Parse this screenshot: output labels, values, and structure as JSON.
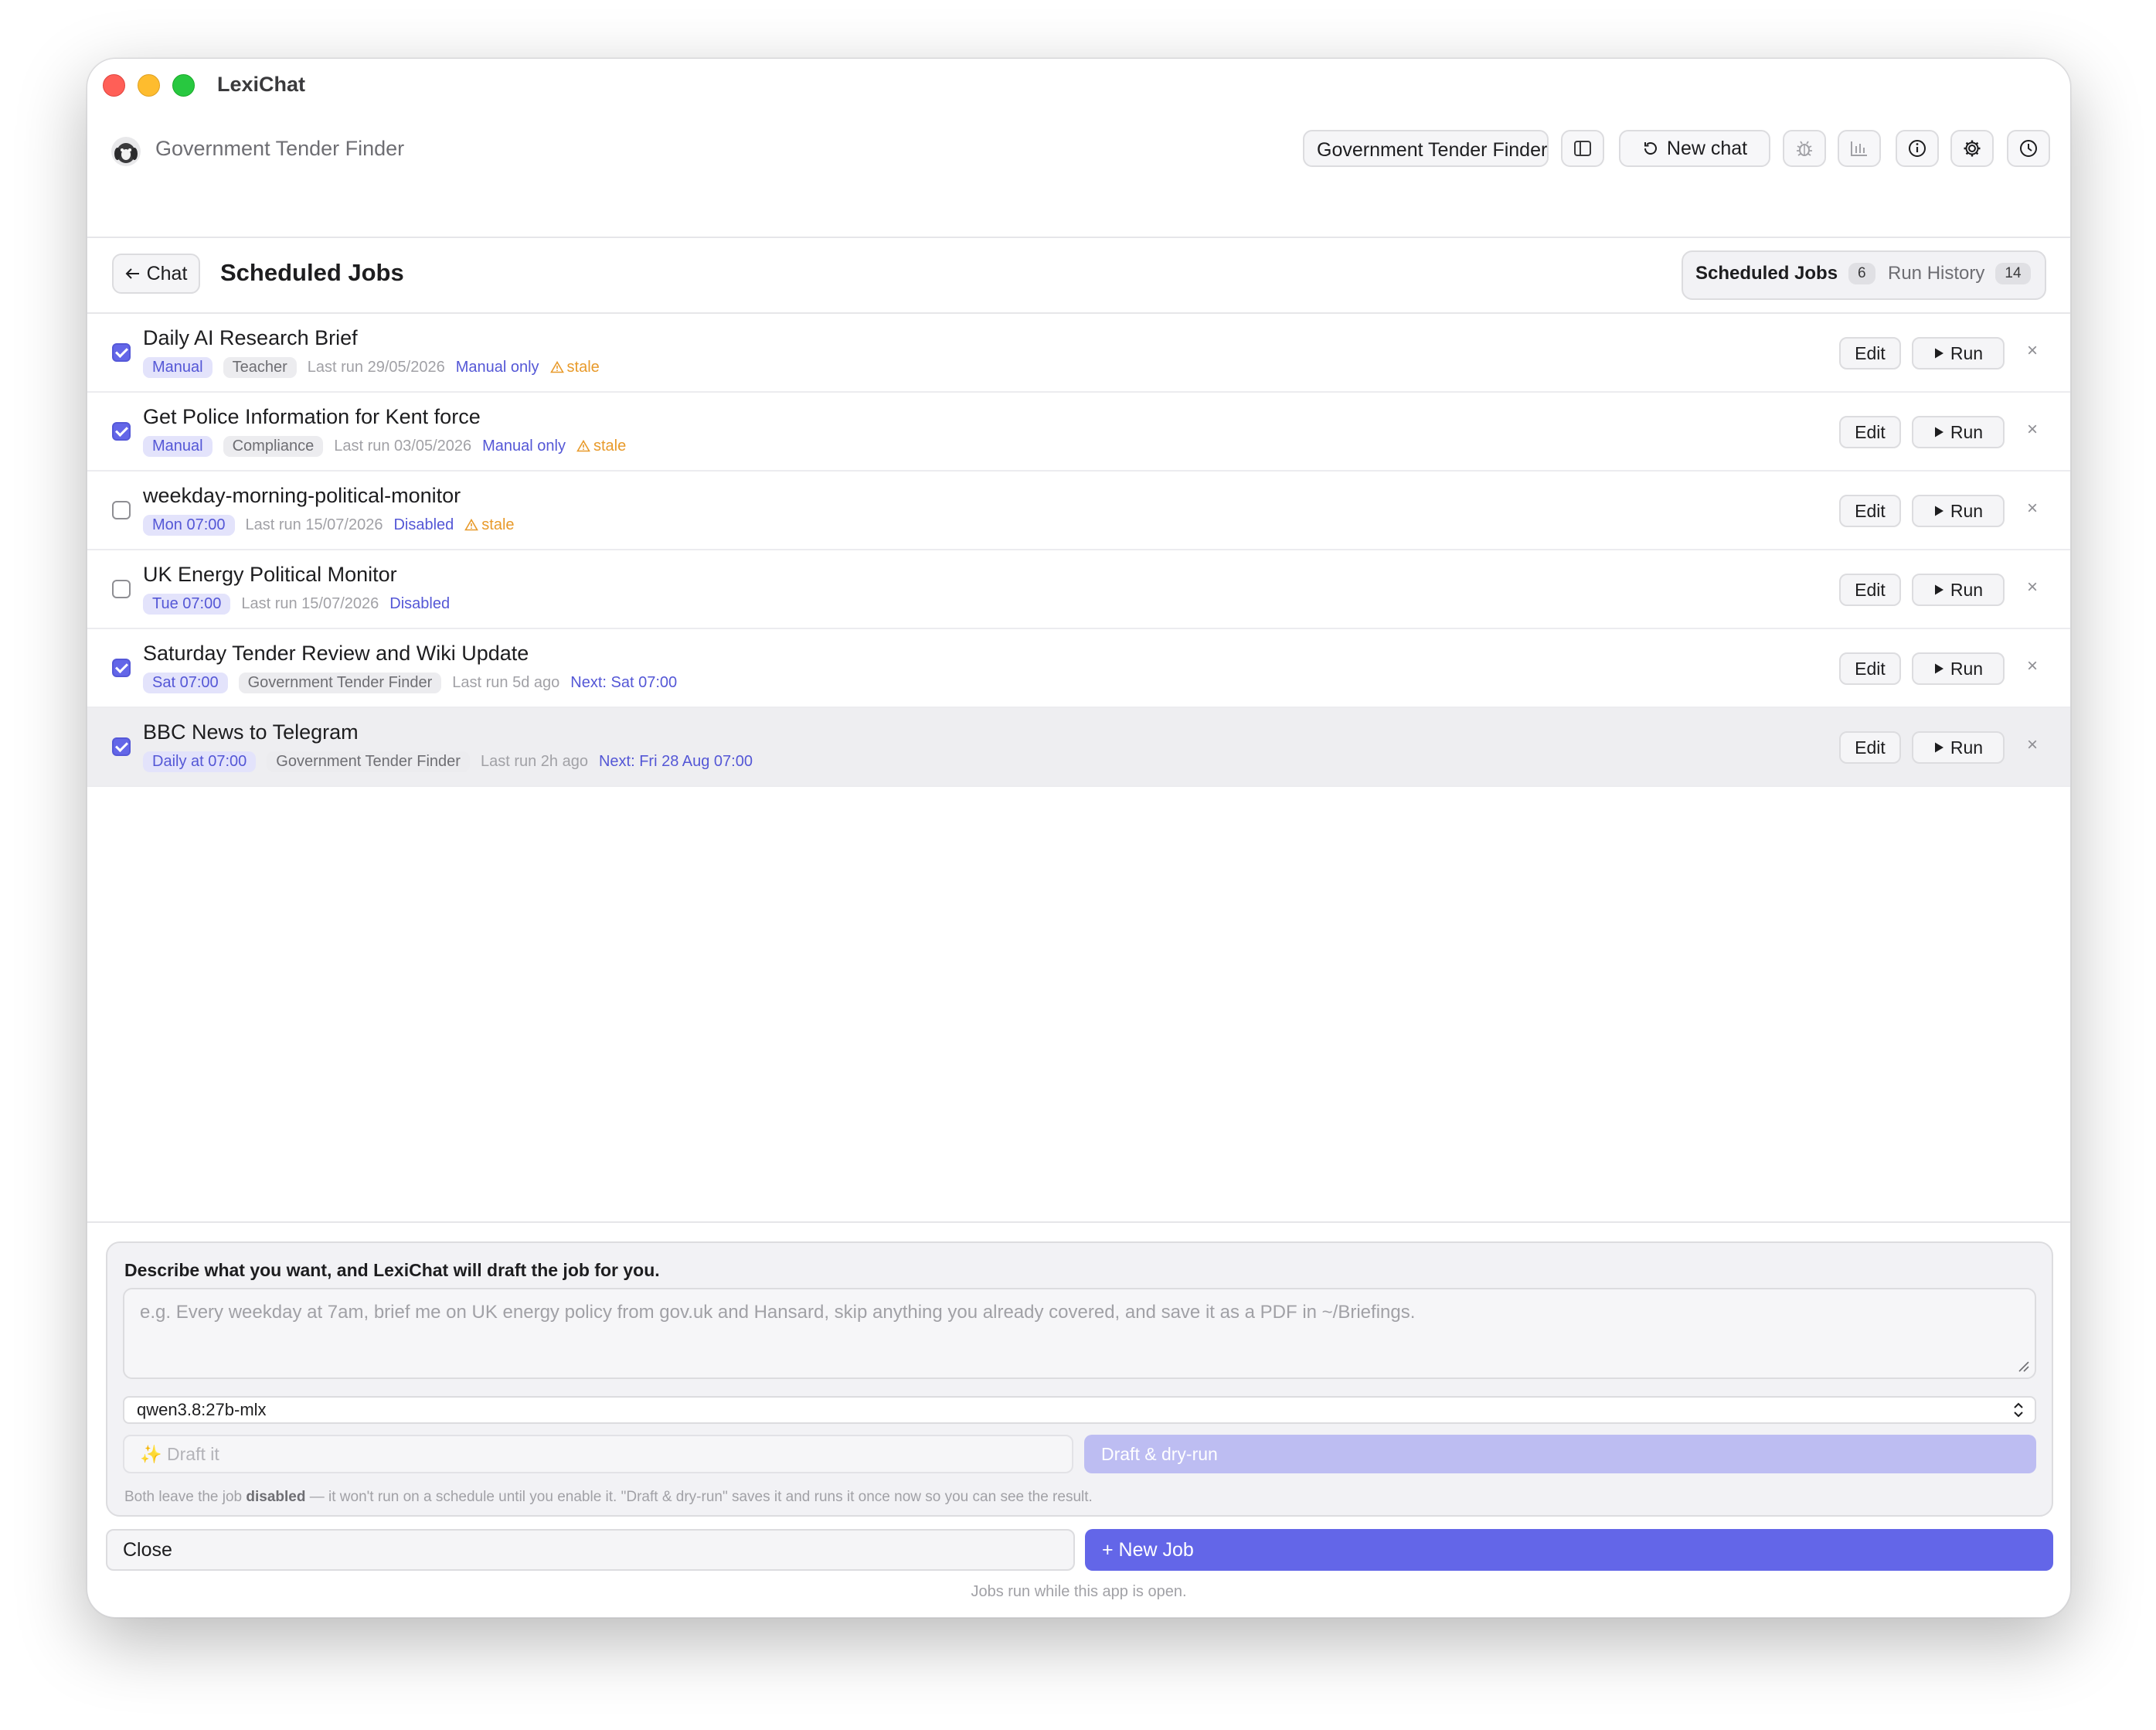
{
  "window": {
    "app_title": "LexiChat"
  },
  "header": {
    "title": "Government Tender Finder",
    "project_select_value": "Government Tender Finder",
    "new_chat_label": "New chat"
  },
  "subheader": {
    "back_label": "Chat",
    "title": "Scheduled Jobs",
    "tabs": [
      {
        "label": "Scheduled Jobs",
        "count": "6",
        "active": true
      },
      {
        "label": "Run History",
        "count": "14",
        "active": false
      }
    ]
  },
  "jobs": [
    {
      "name": "Daily AI Research Brief",
      "enabled": true,
      "schedule": "Manual",
      "category": "Teacher",
      "last_run": "Last run 29/05/2026",
      "state": "Manual only",
      "stale": "stale",
      "selected": false
    },
    {
      "name": "Get Police Information for Kent force",
      "enabled": true,
      "schedule": "Manual",
      "category": "Compliance",
      "last_run": "Last run 03/05/2026",
      "state": "Manual only",
      "stale": "stale",
      "selected": false
    },
    {
      "name": "weekday-morning-political-monitor",
      "enabled": false,
      "schedule": "Mon 07:00",
      "category": "",
      "last_run": "Last run 15/07/2026",
      "state": "Disabled",
      "stale": "stale",
      "selected": false
    },
    {
      "name": "UK Energy Political Monitor",
      "enabled": false,
      "schedule": "Tue 07:00",
      "category": "",
      "last_run": "Last run 15/07/2026",
      "state": "Disabled",
      "stale": "",
      "selected": false
    },
    {
      "name": "Saturday Tender Review and Wiki Update",
      "enabled": true,
      "schedule": "Sat 07:00",
      "category": "Government Tender Finder",
      "last_run": "Last run 5d ago",
      "state": "Next: Sat 07:00",
      "stale": "",
      "selected": false
    },
    {
      "name": "BBC News to Telegram",
      "enabled": true,
      "schedule": "Daily at 07:00",
      "category": "Government Tender Finder",
      "last_run": "Last run 2h ago",
      "state": "Next: Fri 28 Aug 07:00",
      "stale": "",
      "selected": true
    }
  ],
  "row_actions": {
    "edit_label": "Edit",
    "run_label": "Run",
    "delete_label": "×"
  },
  "draft": {
    "label": "Describe what you want, and LexiChat will draft the job for you.",
    "placeholder": "e.g. Every weekday at 7am, brief me on UK energy policy from gov.uk and Hansard, skip anything you already covered, and save it as a PDF in ~/Briefings.",
    "model": "qwen3.8:27b-mlx",
    "draft_it_label": "✨ Draft it",
    "dry_run_label": "Draft & dry-run",
    "hint_prefix": "Both leave the job ",
    "hint_bold": "disabled",
    "hint_suffix": " — it won't run on a schedule until you enable it. \"Draft & dry-run\" saves it and runs it once now so you can see the result."
  },
  "footer": {
    "close_label": "Close",
    "new_job_label": "+ New Job",
    "note": "Jobs run while this app is open."
  },
  "colors": {
    "accent": "#6366e8",
    "stale": "#e89a2a",
    "muted": "#a1a1a6"
  },
  "icons": [
    "sidebar-toggle-icon",
    "refresh-icon",
    "bug-icon",
    "chart-icon",
    "info-icon",
    "gear-icon",
    "clock-icon",
    "back-arrow-icon",
    "play-icon",
    "warning-icon"
  ]
}
